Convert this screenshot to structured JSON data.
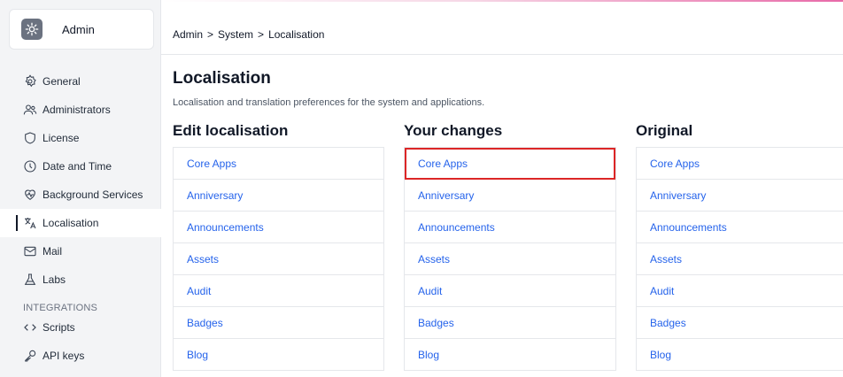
{
  "sidebar": {
    "brand": "Admin",
    "items": [
      {
        "label": "General",
        "icon": "gear-outline-icon"
      },
      {
        "label": "Administrators",
        "icon": "users-icon"
      },
      {
        "label": "License",
        "icon": "shield-icon"
      },
      {
        "label": "Date and Time",
        "icon": "clock-icon"
      },
      {
        "label": "Background Services",
        "icon": "heartbeat-icon"
      },
      {
        "label": "Localisation",
        "icon": "translate-icon",
        "active": true
      },
      {
        "label": "Mail",
        "icon": "mail-icon"
      },
      {
        "label": "Labs",
        "icon": "flask-icon"
      }
    ],
    "section": "INTEGRATIONS",
    "integrations": [
      {
        "label": "Scripts",
        "icon": "code-icon"
      },
      {
        "label": "API keys",
        "icon": "key-icon"
      }
    ]
  },
  "breadcrumb": {
    "items": [
      "Admin",
      "System",
      "Localisation"
    ],
    "separator": ">"
  },
  "page": {
    "title": "Localisation",
    "subtitle": "Localisation and translation preferences for the system and applications."
  },
  "columns": [
    {
      "title": "Edit localisation",
      "rows": [
        "Core Apps",
        "Anniversary",
        "Announcements",
        "Assets",
        "Audit",
        "Badges",
        "Blog"
      ]
    },
    {
      "title": "Your changes",
      "rows": [
        "Core Apps",
        "Anniversary",
        "Announcements",
        "Assets",
        "Audit",
        "Badges",
        "Blog"
      ],
      "highlighted_row": 0
    },
    {
      "title": "Original",
      "rows": [
        "Core Apps",
        "Anniversary",
        "Announcements",
        "Assets",
        "Audit",
        "Badges",
        "Blog"
      ]
    }
  ],
  "colors": {
    "link": "#2563eb",
    "highlight": "#dc2626",
    "sidebar_bg": "#f3f4f6"
  }
}
